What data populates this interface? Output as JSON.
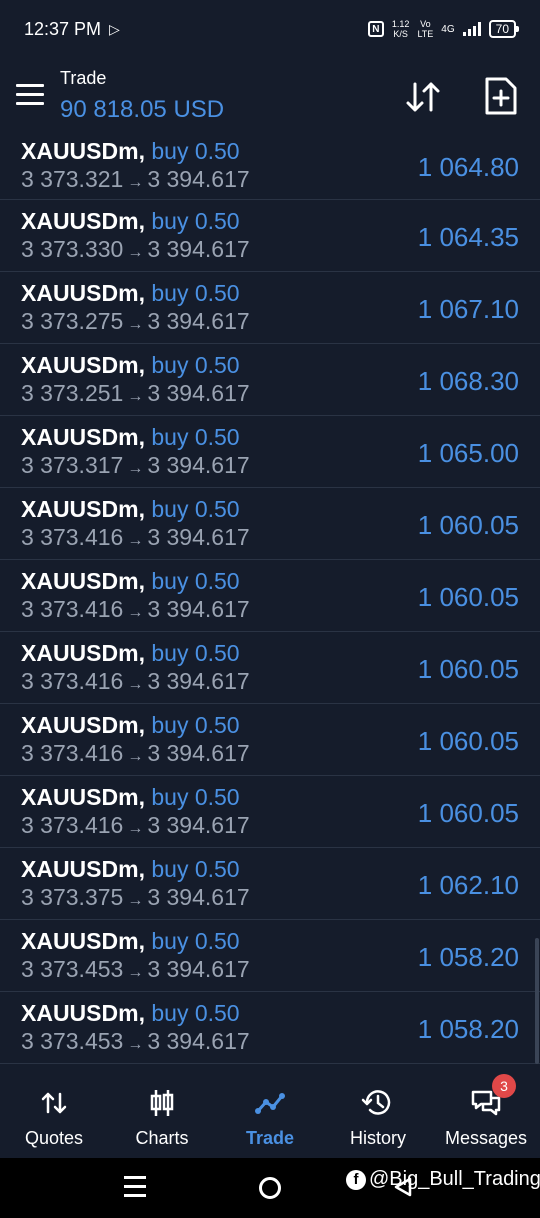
{
  "status_bar": {
    "time": "12:37 PM",
    "speed_value": "1.12",
    "speed_unit": "K/S",
    "volte_top": "Vo",
    "volte_bottom": "LTE",
    "network": "4G",
    "battery": "70",
    "icons": [
      "play-store-icon",
      "nfc-icon",
      "signal-icon",
      "battery-icon"
    ]
  },
  "header": {
    "title": "Trade",
    "balance": "90 818.05 USD",
    "accent_color": "#4a90e2"
  },
  "trades": [
    {
      "symbol": "XAUUSDm,",
      "side": "buy 0.50",
      "open_price": "3 373.321",
      "arrow": "→",
      "current_price": "3 394.617",
      "profit": "1 064.80"
    },
    {
      "symbol": "XAUUSDm,",
      "side": "buy 0.50",
      "open_price": "3 373.330",
      "arrow": "→",
      "current_price": "3 394.617",
      "profit": "1 064.35"
    },
    {
      "symbol": "XAUUSDm,",
      "side": "buy 0.50",
      "open_price": "3 373.275",
      "arrow": "→",
      "current_price": "3 394.617",
      "profit": "1 067.10"
    },
    {
      "symbol": "XAUUSDm,",
      "side": "buy 0.50",
      "open_price": "3 373.251",
      "arrow": "→",
      "current_price": "3 394.617",
      "profit": "1 068.30"
    },
    {
      "symbol": "XAUUSDm,",
      "side": "buy 0.50",
      "open_price": "3 373.317",
      "arrow": "→",
      "current_price": "3 394.617",
      "profit": "1 065.00"
    },
    {
      "symbol": "XAUUSDm,",
      "side": "buy 0.50",
      "open_price": "3 373.416",
      "arrow": "→",
      "current_price": "3 394.617",
      "profit": "1 060.05"
    },
    {
      "symbol": "XAUUSDm,",
      "side": "buy 0.50",
      "open_price": "3 373.416",
      "arrow": "→",
      "current_price": "3 394.617",
      "profit": "1 060.05"
    },
    {
      "symbol": "XAUUSDm,",
      "side": "buy 0.50",
      "open_price": "3 373.416",
      "arrow": "→",
      "current_price": "3 394.617",
      "profit": "1 060.05"
    },
    {
      "symbol": "XAUUSDm,",
      "side": "buy 0.50",
      "open_price": "3 373.416",
      "arrow": "→",
      "current_price": "3 394.617",
      "profit": "1 060.05"
    },
    {
      "symbol": "XAUUSDm,",
      "side": "buy 0.50",
      "open_price": "3 373.416",
      "arrow": "→",
      "current_price": "3 394.617",
      "profit": "1 060.05"
    },
    {
      "symbol": "XAUUSDm,",
      "side": "buy 0.50",
      "open_price": "3 373.375",
      "arrow": "→",
      "current_price": "3 394.617",
      "profit": "1 062.10"
    },
    {
      "symbol": "XAUUSDm,",
      "side": "buy 0.50",
      "open_price": "3 373.453",
      "arrow": "→",
      "current_price": "3 394.617",
      "profit": "1 058.20"
    },
    {
      "symbol": "XAUUSDm,",
      "side": "buy 0.50",
      "open_price": "3 373.453",
      "arrow": "→",
      "current_price": "3 394.617",
      "profit": "1 058.20"
    }
  ],
  "bottom_nav": {
    "items": [
      {
        "label": "Quotes",
        "icon": "quotes-icon"
      },
      {
        "label": "Charts",
        "icon": "charts-icon"
      },
      {
        "label": "Trade",
        "icon": "trade-icon",
        "active": true
      },
      {
        "label": "History",
        "icon": "history-icon"
      },
      {
        "label": "Messages",
        "icon": "messages-icon",
        "badge": "3"
      }
    ]
  },
  "watermark": {
    "text": "@Big_Bull_Trading)"
  }
}
